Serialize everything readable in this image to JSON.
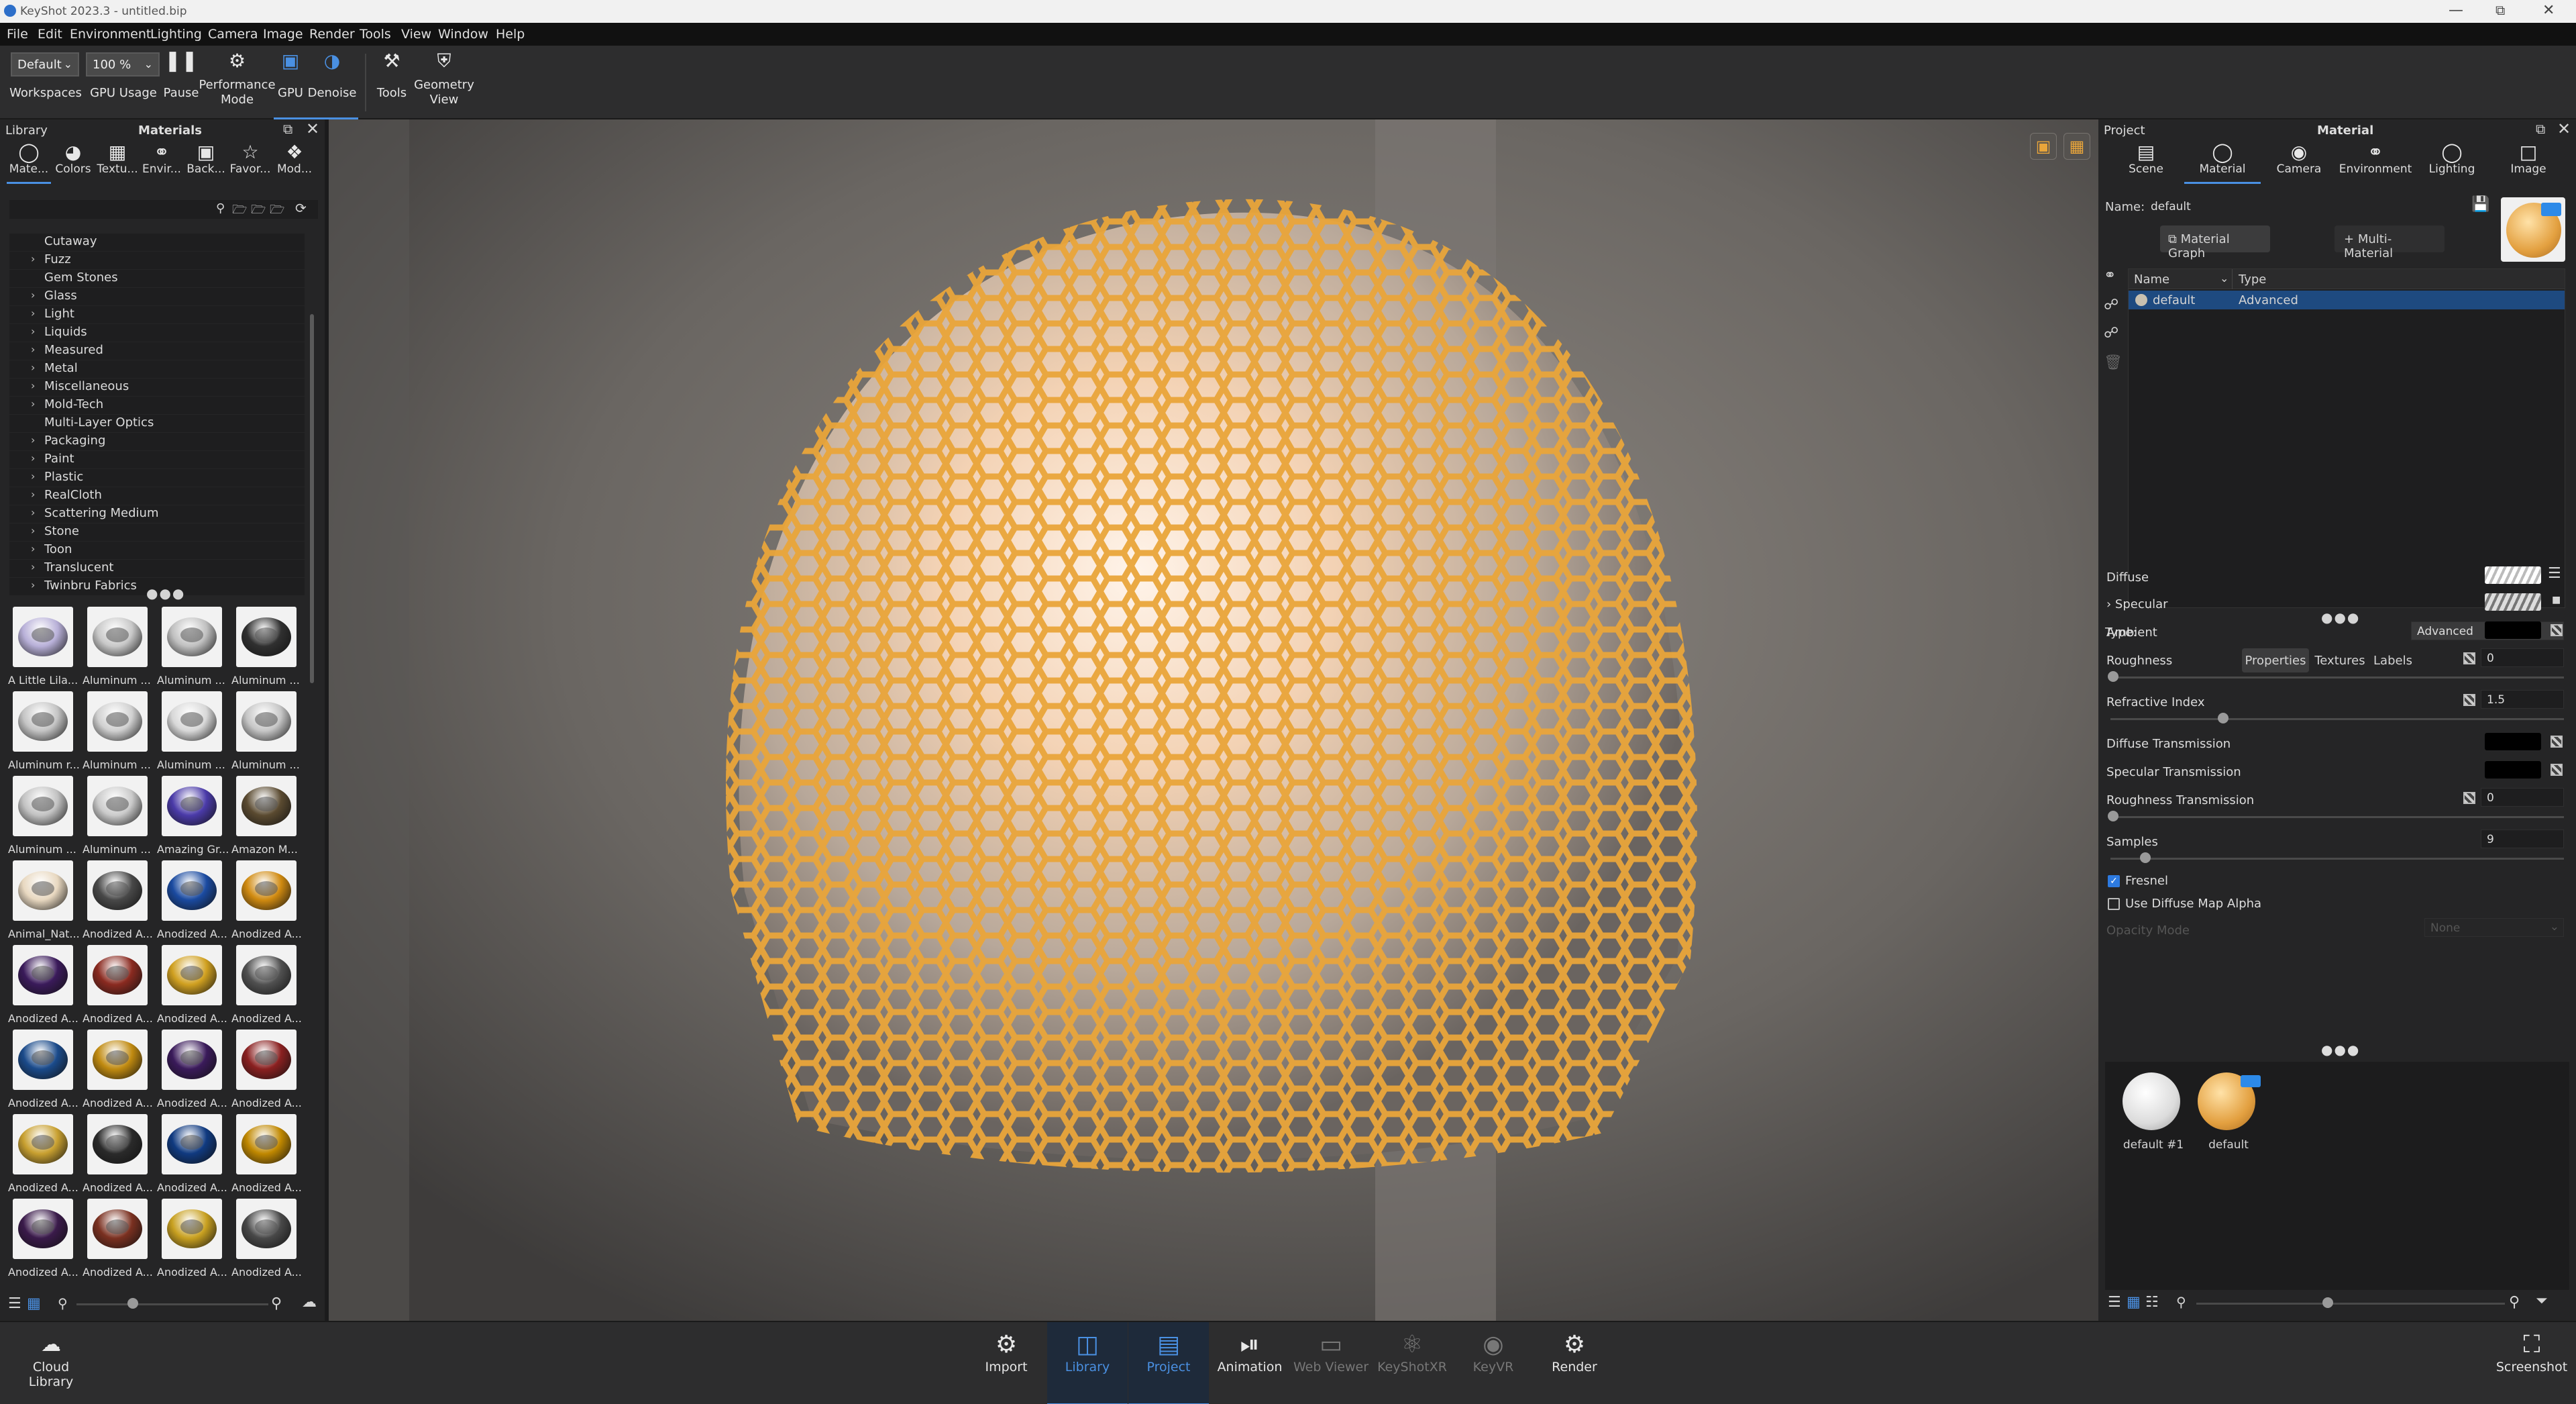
{
  "window": {
    "title": "KeyShot 2023.3  - untitled.bip"
  },
  "menu": [
    "File",
    "Edit",
    "Environment",
    "Lighting",
    "Camera",
    "Image",
    "Render",
    "Tools",
    "View",
    "Window",
    "Help"
  ],
  "toolbar": {
    "workspace_value": "Default",
    "workspace_label": "Workspaces",
    "gpu_usage_value": "100 %",
    "gpu_usage_label": "GPU Usage",
    "pause_label": "Pause",
    "performance_label_1": "Performance",
    "performance_label_2": "Mode",
    "gpu_label": "GPU",
    "denoise_label": "Denoise",
    "tools_label": "Tools",
    "geometry_label_1": "Geometry",
    "geometry_label_2": "View"
  },
  "library": {
    "panel_title": "Library",
    "section_title": "Materials",
    "tabs": [
      {
        "label": "Mate...",
        "icon": "material-icon"
      },
      {
        "label": "Colors",
        "icon": "palette-icon"
      },
      {
        "label": "Textu...",
        "icon": "texture-icon"
      },
      {
        "label": "Envir...",
        "icon": "globe-icon"
      },
      {
        "label": "Back...",
        "icon": "image-icon"
      },
      {
        "label": "Favor...",
        "icon": "star-icon"
      },
      {
        "label": "Mod...",
        "icon": "model-icon"
      }
    ],
    "tree": [
      {
        "label": "Cutaway",
        "expandable": false
      },
      {
        "label": "Fuzz",
        "expandable": true
      },
      {
        "label": "Gem Stones",
        "expandable": false
      },
      {
        "label": "Glass",
        "expandable": true
      },
      {
        "label": "Light",
        "expandable": true
      },
      {
        "label": "Liquids",
        "expandable": true
      },
      {
        "label": "Measured",
        "expandable": true
      },
      {
        "label": "Metal",
        "expandable": true
      },
      {
        "label": "Miscellaneous",
        "expandable": true
      },
      {
        "label": "Mold-Tech",
        "expandable": true
      },
      {
        "label": "Multi-Layer Optics",
        "expandable": false
      },
      {
        "label": "Packaging",
        "expandable": true
      },
      {
        "label": "Paint",
        "expandable": true
      },
      {
        "label": "Plastic",
        "expandable": true
      },
      {
        "label": "RealCloth",
        "expandable": true
      },
      {
        "label": "Scattering Medium",
        "expandable": true
      },
      {
        "label": "Stone",
        "expandable": true
      },
      {
        "label": "Toon",
        "expandable": true
      },
      {
        "label": "Translucent",
        "expandable": true
      },
      {
        "label": "Twinbru Fabrics",
        "expandable": true
      }
    ],
    "thumbnails": [
      {
        "label": "A Little Lila...",
        "color": "#b8b0d8"
      },
      {
        "label": "Aluminum ...",
        "color": "#c8c8c8"
      },
      {
        "label": "Aluminum ...",
        "color": "#c0c0c0"
      },
      {
        "label": "Aluminum ...",
        "color": "#303030"
      },
      {
        "label": "Aluminum r...",
        "color": "#c4c4c4"
      },
      {
        "label": "Aluminum ...",
        "color": "#d0d0d0"
      },
      {
        "label": "Aluminum ...",
        "color": "#d8d8d8"
      },
      {
        "label": "Aluminum ...",
        "color": "#c6c6c6"
      },
      {
        "label": "Aluminum ...",
        "color": "#c2c2c2"
      },
      {
        "label": "Aluminum ...",
        "color": "#cacaca"
      },
      {
        "label": "Amazing Gr...",
        "color": "#4a3aa8"
      },
      {
        "label": "Amazon M...",
        "color": "#5a4a30"
      },
      {
        "label": "Animal_Nat...",
        "color": "#e8d8c0"
      },
      {
        "label": "Anodized A...",
        "color": "#484848"
      },
      {
        "label": "Anodized A...",
        "color": "#1a4aa0"
      },
      {
        "label": "Anodized A...",
        "color": "#d08a10"
      },
      {
        "label": "Anodized A...",
        "color": "#3a1a5a"
      },
      {
        "label": "Anodized A...",
        "color": "#8a2a20"
      },
      {
        "label": "Anodized A...",
        "color": "#d0a020"
      },
      {
        "label": "Anodized A...",
        "color": "#505050"
      },
      {
        "label": "Anodized A...",
        "color": "#1a4a8a"
      },
      {
        "label": "Anodized A...",
        "color": "#c08a10"
      },
      {
        "label": "Anodized A...",
        "color": "#3a1a5a"
      },
      {
        "label": "Anodized A...",
        "color": "#8a2020"
      },
      {
        "label": "Anodized A...",
        "color": "#c8a030"
      },
      {
        "label": "Anodized A...",
        "color": "#2a2a2a"
      },
      {
        "label": "Anodized A...",
        "color": "#103a80"
      },
      {
        "label": "Anodized A...",
        "color": "#c08800"
      },
      {
        "label": "Anodized A...",
        "color": "#3a1a4a"
      },
      {
        "label": "Anodized A...",
        "color": "#7a3020"
      },
      {
        "label": "Anodized A...",
        "color": "#c8a020"
      },
      {
        "label": "Anodized A...",
        "color": "#484848"
      }
    ]
  },
  "project": {
    "panel_title": "Project",
    "section_title": "Material",
    "tabs": [
      {
        "label": "Scene",
        "icon": "scene-icon"
      },
      {
        "label": "Material",
        "icon": "material-icon"
      },
      {
        "label": "Camera",
        "icon": "camera-icon"
      },
      {
        "label": "Environment",
        "icon": "globe-icon"
      },
      {
        "label": "Lighting",
        "icon": "bulb-icon"
      },
      {
        "label": "Image",
        "icon": "crop-icon"
      }
    ],
    "name_label": "Name:",
    "name_value": "default",
    "material_graph_label": "Material Graph",
    "multi_material_label": "Multi-Material",
    "table_headers": [
      "Name",
      "Type"
    ],
    "table_rows": [
      {
        "name": "default",
        "type": "Advanced"
      }
    ],
    "type_label": "Type:",
    "type_value": "Advanced",
    "subtabs": [
      "Properties",
      "Textures",
      "Labels"
    ],
    "props": {
      "diffuse": "Diffuse",
      "specular": "Specular",
      "ambient": "Ambient",
      "roughness": "Roughness",
      "roughness_value": "0",
      "refractive_index": "Refractive Index",
      "refractive_index_value": "1.5",
      "diffuse_transmission": "Diffuse Transmission",
      "specular_transmission": "Specular Transmission",
      "roughness_transmission": "Roughness Transmission",
      "roughness_transmission_value": "0",
      "samples": "Samples",
      "samples_value": "9",
      "fresnel": "Fresnel",
      "use_diffuse_map_alpha": "Use Diffuse Map Alpha",
      "opacity_mode": "Opacity Mode",
      "opacity_mode_value": "None"
    },
    "materials_in_scene": [
      {
        "label": "default #1"
      },
      {
        "label": "default"
      }
    ]
  },
  "bottom": {
    "cloud_label_1": "Cloud",
    "cloud_label_2": "Library",
    "buttons": [
      {
        "label": "Import",
        "icon": "import-icon"
      },
      {
        "label": "Library",
        "icon": "book-icon"
      },
      {
        "label": "Project",
        "icon": "list-icon"
      },
      {
        "label": "Animation",
        "icon": "play-icon"
      },
      {
        "label": "Web Viewer",
        "icon": "monitor-icon"
      },
      {
        "label": "KeyShotXR",
        "icon": "xr-icon"
      },
      {
        "label": "KeyVR",
        "icon": "vr-icon"
      },
      {
        "label": "Render",
        "icon": "render-icon"
      }
    ],
    "screenshot_label": "Screenshot"
  },
  "colors": {
    "accent": "#4a90e2",
    "selection": "#1e4a80",
    "mesh": "#e9a53a"
  }
}
